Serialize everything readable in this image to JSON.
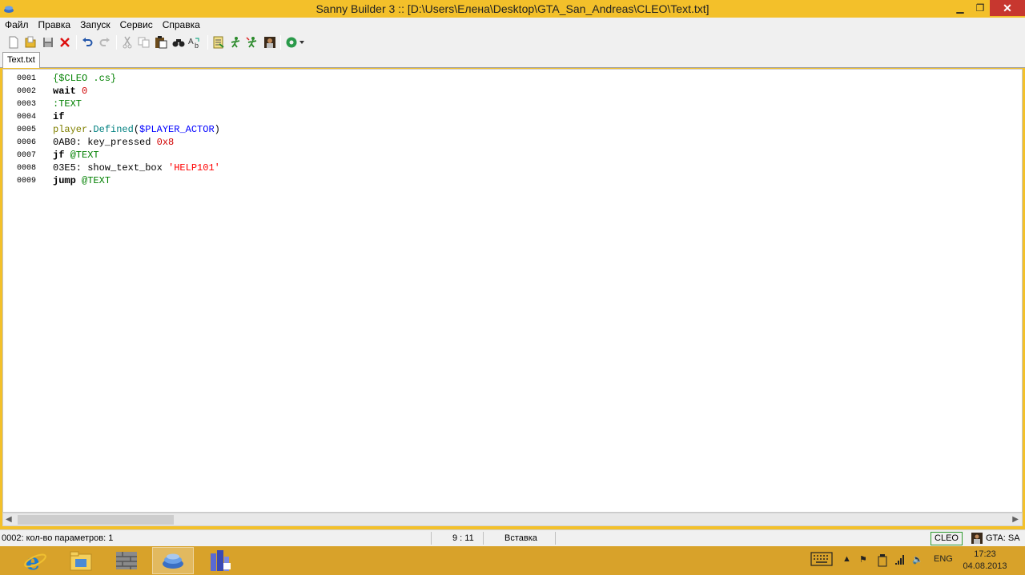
{
  "window": {
    "title": "Sanny Builder 3 :: [D:\\Users\\Елена\\Desktop\\GTA_San_Andreas\\CLEO\\Text.txt]",
    "close_color": "#c7372f",
    "titlebar_color": "#f3c02a"
  },
  "menu": [
    "Файл",
    "Правка",
    "Запуск",
    "Сервис",
    "Справка"
  ],
  "toolbar": {
    "icons": [
      "new-file-icon",
      "open-folder-icon",
      "save-icon",
      "close-file-icon",
      "undo-icon",
      "redo-icon",
      "cut-icon",
      "copy-icon",
      "paste-icon",
      "find-icon",
      "replace-icon",
      "compile-icon",
      "compile-run-icon",
      "run-icon",
      "game-icon",
      "options-icon"
    ]
  },
  "tabs": [
    {
      "label": "Text.txt",
      "active": true
    }
  ],
  "editor": {
    "lines": [
      {
        "number": "0001",
        "tokens": [
          {
            "text": "{$CLEO .cs}",
            "kind": "dir"
          }
        ]
      },
      {
        "number": "0002",
        "tokens": [
          {
            "text": "wait",
            "kind": "kw"
          },
          {
            "text": " ",
            "kind": "plain"
          },
          {
            "text": "0",
            "kind": "num"
          }
        ]
      },
      {
        "number": "0003",
        "tokens": [
          {
            "text": ":TEXT",
            "kind": "label"
          }
        ]
      },
      {
        "number": "0004",
        "tokens": [
          {
            "text": "if",
            "kind": "kw"
          }
        ]
      },
      {
        "number": "0005",
        "tokens": [
          {
            "text": "player",
            "kind": "cls"
          },
          {
            "text": ".",
            "kind": "plain"
          },
          {
            "text": "Defined",
            "kind": "meth"
          },
          {
            "text": "(",
            "kind": "plain"
          },
          {
            "text": "$PLAYER_ACTOR",
            "kind": "gvar"
          },
          {
            "text": ")",
            "kind": "plain"
          }
        ]
      },
      {
        "number": "0006",
        "tokens": [
          {
            "text": "0AB0: key_pressed ",
            "kind": "plain"
          },
          {
            "text": "0x8",
            "kind": "num"
          }
        ]
      },
      {
        "number": "0007",
        "tokens": [
          {
            "text": "jf",
            "kind": "kw"
          },
          {
            "text": " ",
            "kind": "plain"
          },
          {
            "text": "@TEXT",
            "kind": "label"
          }
        ]
      },
      {
        "number": "0008",
        "tokens": [
          {
            "text": "03E5: show_text_box ",
            "kind": "plain"
          },
          {
            "text": "'HELP101'",
            "kind": "str"
          }
        ]
      },
      {
        "number": "0009",
        "tokens": [
          {
            "text": "jump",
            "kind": "kw"
          },
          {
            "text": " ",
            "kind": "plain"
          },
          {
            "text": "@TEXT",
            "kind": "label"
          }
        ]
      }
    ]
  },
  "statusbar": {
    "hint": "0002: кол-во параметров: 1",
    "position": "9 : 11",
    "mode": "Вставка",
    "edit_mode": "CLEO",
    "game": "GTA: SA"
  },
  "taskbar": {
    "apps": [
      "internet-explorer-icon",
      "file-explorer-icon",
      "wall-app-icon",
      "sanny-builder-icon",
      "city-app-icon"
    ],
    "active_index": 3,
    "language": "ENG",
    "time": "17:23",
    "date": "04.08.2013"
  }
}
